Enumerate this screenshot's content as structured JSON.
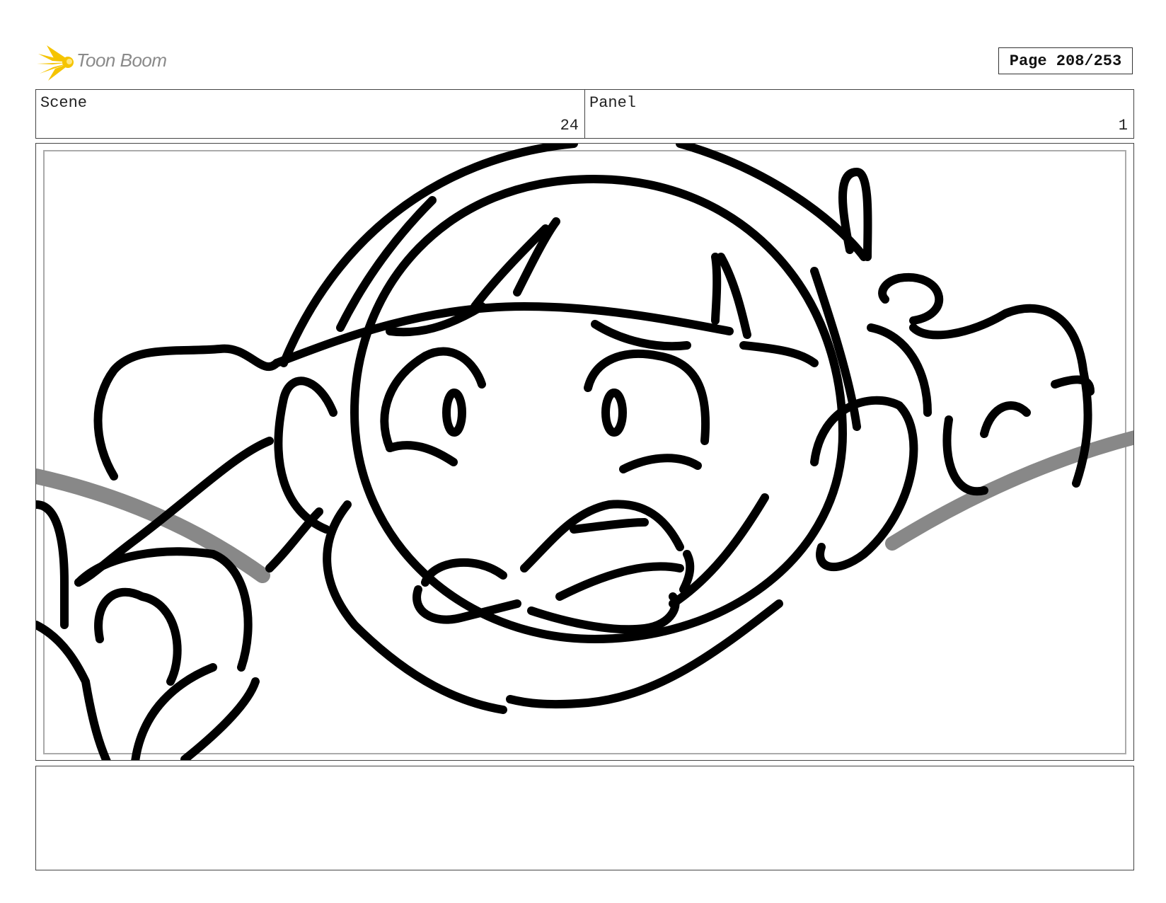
{
  "brand": {
    "name": "Toon Boom",
    "accent_color": "#f5c400",
    "icon": "starburst-logo-icon"
  },
  "page_indicator": "Page 208/253",
  "header": {
    "scene_label": "Scene",
    "scene_value": "24",
    "panel_label": "Panel",
    "panel_value": "1"
  },
  "drawing": {
    "icon": "storyboard-sketch-drawing"
  },
  "notes": {
    "text": ""
  }
}
